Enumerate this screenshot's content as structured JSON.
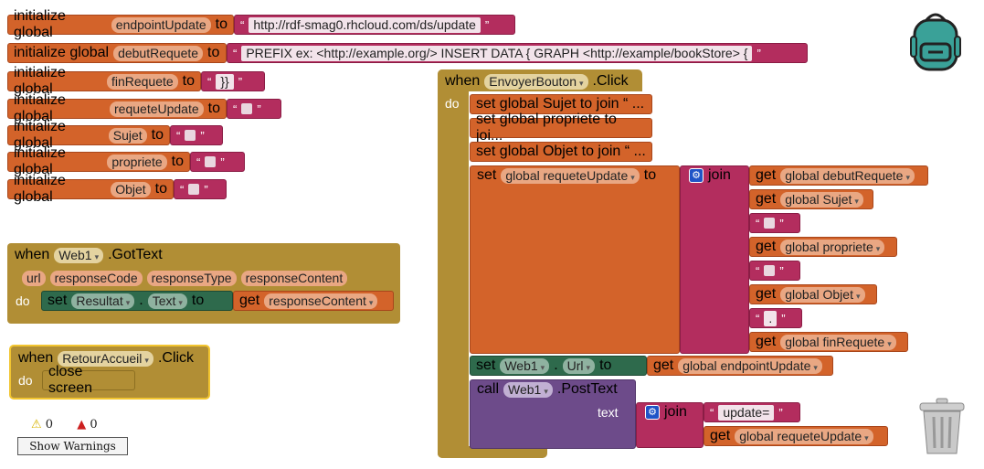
{
  "init_label": "initialize global",
  "to_label": "to",
  "globals": [
    {
      "name": "endpointUpdate",
      "value": "http://rdf-smag0.rhcloud.com/ds/update"
    },
    {
      "name": "debutRequete",
      "value": "PREFIX ex:   <http://example.org/> INSERT DATA { GRAPH <http://example/bookStore> { "
    },
    {
      "name": "finRequete",
      "value": "}}"
    },
    {
      "name": "requeteUpdate",
      "value": ""
    },
    {
      "name": "Sujet",
      "value": ""
    },
    {
      "name": "propriete",
      "value": ""
    },
    {
      "name": "Objet",
      "value": ""
    }
  ],
  "web_gottext": {
    "when": "when",
    "component": "Web1",
    "event": ".GotText",
    "params": [
      "url",
      "responseCode",
      "responseType",
      "responseContent"
    ],
    "do": "do",
    "set": "set",
    "target": "Resultat",
    "dot": ".",
    "prop": "Text",
    "to": "to",
    "get": "get",
    "get_var": "responseContent"
  },
  "retour": {
    "when": "when",
    "component": "RetourAccueil",
    "event": ".Click",
    "do": "do",
    "action": "close screen"
  },
  "envoyer": {
    "when": "when",
    "component": "EnvoyerBouton",
    "event": ".Click",
    "do": "do",
    "stmt1": "set global Sujet to join “ ...",
    "stmt2": "set global propriete to joi...",
    "stmt3": "set global Objet to join “ ...",
    "set": "set",
    "set_var": "global requeteUpdate",
    "to": "to",
    "join": "join",
    "get": "get",
    "join_items": [
      "global debutRequete",
      "global Sujet",
      "global propriete",
      "global Objet",
      "global finRequete"
    ],
    "dot_string": ".",
    "set_web": "set",
    "web": "Web1",
    "url_prop": "Url",
    "web_to": "to",
    "endpoint_get": "global endpointUpdate",
    "call": "call",
    "call_web": "Web1",
    "post": ".PostText",
    "text": "text",
    "update_string": "update=",
    "get_requete": "global requeteUpdate"
  },
  "warnings": {
    "warn_count": "0",
    "error_count": "0",
    "button": "Show Warnings"
  },
  "colors": {
    "variable": "#d3632a",
    "text": "#b32d5e",
    "event": "#b18e35",
    "component": "#2e6a4c",
    "call": "#6d4b8a"
  }
}
